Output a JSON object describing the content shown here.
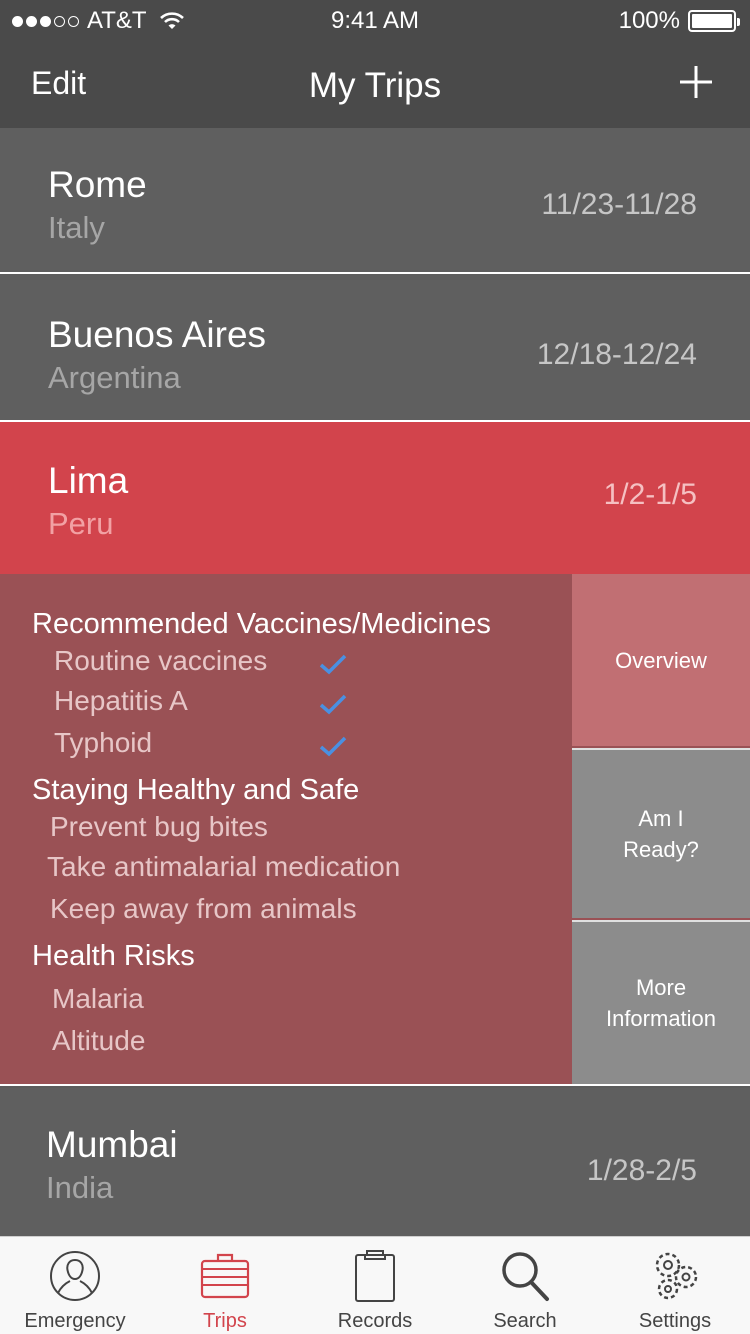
{
  "status_bar": {
    "carrier": "AT&T",
    "time": "9:41 AM",
    "battery": "100%"
  },
  "nav": {
    "edit_label": "Edit",
    "title": "My Trips"
  },
  "trips": [
    {
      "city": "Rome",
      "country": "Italy",
      "dates": "11/23-11/28"
    },
    {
      "city": "Buenos Aires",
      "country": "Argentina",
      "dates": "12/18-12/24"
    },
    {
      "city": "Lima",
      "country": "Peru",
      "dates": "1/2-1/5"
    },
    {
      "city": "Mumbai",
      "country": "India",
      "dates": "1/28-2/5"
    }
  ],
  "detail": {
    "vaccines": {
      "title": "Recommended Vaccines/Medicines",
      "items": [
        {
          "label": "Routine vaccines",
          "checked": true
        },
        {
          "label": "Hepatitis A",
          "checked": true
        },
        {
          "label": "Typhoid",
          "checked": true
        }
      ]
    },
    "healthy": {
      "title": "Staying Healthy and Safe",
      "items": [
        "Prevent bug bites",
        "Take antimalarial medication",
        "Keep away from animals"
      ]
    },
    "risks": {
      "title": "Health Risks",
      "items": [
        "Malaria",
        "Altitude"
      ]
    },
    "side_tabs": {
      "overview": "Overview",
      "ready_line1": "Am I",
      "ready_line2": "Ready?",
      "more_line1": "More",
      "more_line2": "Information"
    }
  },
  "tab_bar": {
    "items": [
      {
        "label": "Emergency",
        "icon": "person-icon"
      },
      {
        "label": "Trips",
        "icon": "suitcase-icon",
        "active": true
      },
      {
        "label": "Records",
        "icon": "clipboard-icon"
      },
      {
        "label": "Search",
        "icon": "search-icon"
      },
      {
        "label": "Settings",
        "icon": "gears-icon"
      }
    ]
  },
  "colors": {
    "accent": "#d2444c",
    "check": "#4a90e2",
    "detail_bg": "#9a5155",
    "row_bg": "#5f5f5f"
  }
}
